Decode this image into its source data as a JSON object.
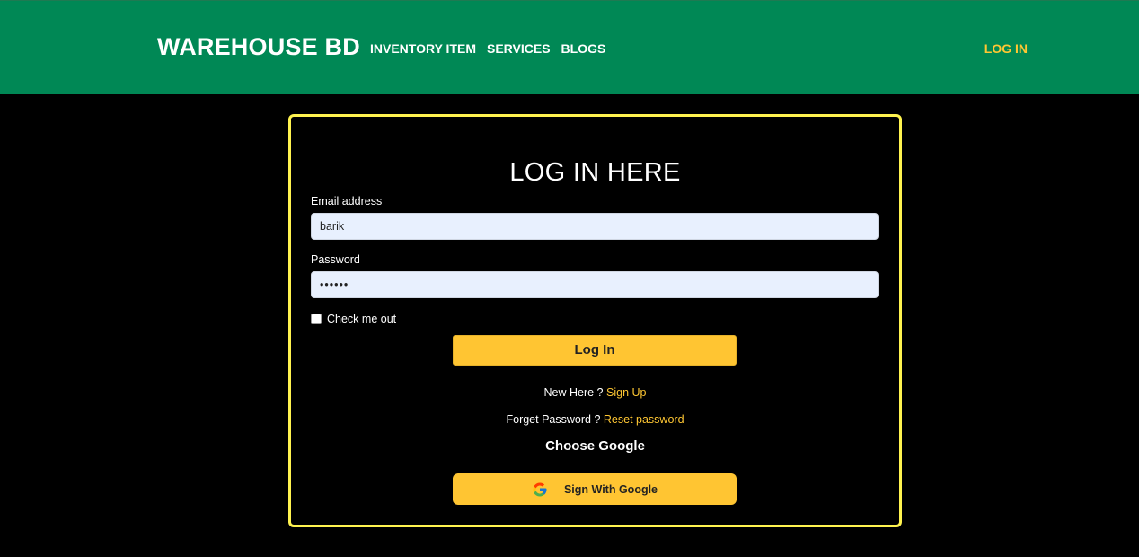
{
  "header": {
    "brand": "WAREHOUSE BD",
    "nav": [
      "INVENTORY ITEM",
      "SERVICES",
      "BLOGS"
    ],
    "login_link": "LOG IN",
    "bg_color": "#008855",
    "accent_color": "#ffc733"
  },
  "login_form": {
    "title": "LOG IN HERE",
    "email_label": "Email address",
    "email_value": "barik",
    "password_label": "Password",
    "password_value": "••••••",
    "checkbox_label": "Check me out",
    "checkbox_checked": false,
    "submit_label": "Log In",
    "new_here_text": "New Here ?",
    "signup_link": "Sign Up",
    "forget_text": "Forget Password ?",
    "reset_link": "Reset password",
    "choose_google": "Choose Google",
    "google_button": "Sign With Google",
    "google_icon": "google-g-icon",
    "border_color": "#fff34f",
    "button_color": "#ffc532"
  }
}
